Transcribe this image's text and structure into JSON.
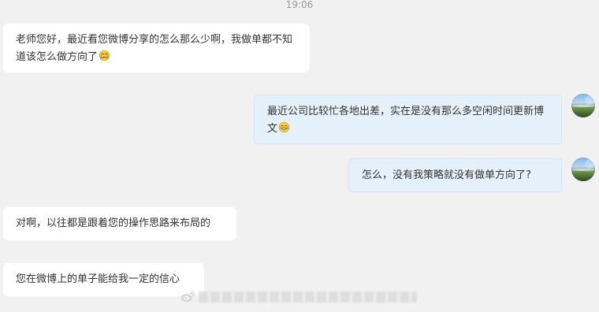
{
  "header": {
    "time": "19:06"
  },
  "messages": [
    {
      "side": "left",
      "text": "老师您好，最近看您微博分享的怎么那么少啊，我做单都不知道该怎么做方向了",
      "emoji": "crying-emoji"
    },
    {
      "side": "right",
      "text": "最近公司比较忙各地出差，实在是没有那么多空闲时间更新博文",
      "emoji": "laughing-emoji"
    },
    {
      "side": "right",
      "text": "怎么，没有我策略就没有做单方向了?",
      "emoji": ""
    },
    {
      "side": "left",
      "text": "对啊，以往都是跟着您的操作思路来布局的",
      "emoji": ""
    },
    {
      "side": "left",
      "text": "您在微博上的单子能给我一定的信心",
      "emoji": ""
    }
  ],
  "watermark": {
    "icon": "weibo-logo"
  },
  "colors": {
    "background": "#f1f1f1",
    "left_bubble": "#ffffff",
    "right_bubble": "#e4f1fb",
    "timestamp": "#999999",
    "text": "#333333"
  }
}
